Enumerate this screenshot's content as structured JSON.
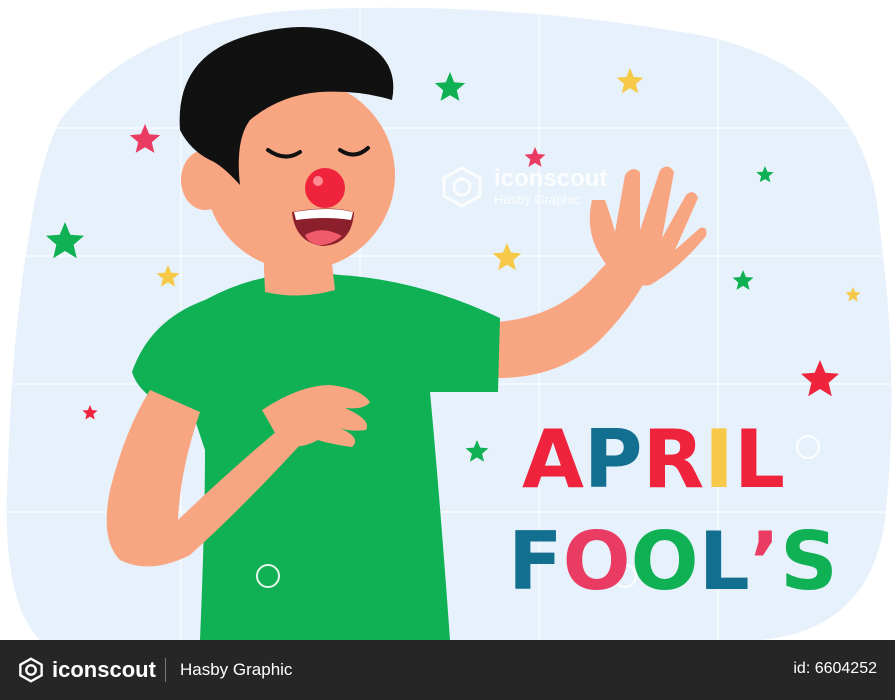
{
  "illustration": {
    "title_line1": [
      "A",
      "P",
      "R",
      "I",
      "L"
    ],
    "title_line2": [
      "F",
      "O",
      "O",
      "L",
      "’",
      "S"
    ],
    "colors": {
      "background_blob": "#e6f1fb",
      "shirt": "#0fb154",
      "skin": "#f8a681",
      "hair": "#111111",
      "clown_nose": "#ef233c",
      "letter_red": "#ef233c",
      "letter_teal": "#136f8f",
      "letter_yellow": "#f7c948",
      "letter_green": "#0fb154",
      "letter_pink": "#ea3b62"
    },
    "title1_colors": [
      "#ef233c",
      "#136f8f",
      "#ef233c",
      "#f7c948",
      "#ef233c"
    ],
    "title2_colors": [
      "#136f8f",
      "#ea3b62",
      "#0fb154",
      "#136f8f",
      "#ea3b62",
      "#0fb154"
    ]
  },
  "watermark": {
    "brand": "iconscout",
    "author": "Hasby Graphic"
  },
  "footer": {
    "brand": "iconscout",
    "author": "Hasby Graphic",
    "asset_id": "id: 6604252",
    "logo_icon": "iconscout-logo-icon"
  }
}
